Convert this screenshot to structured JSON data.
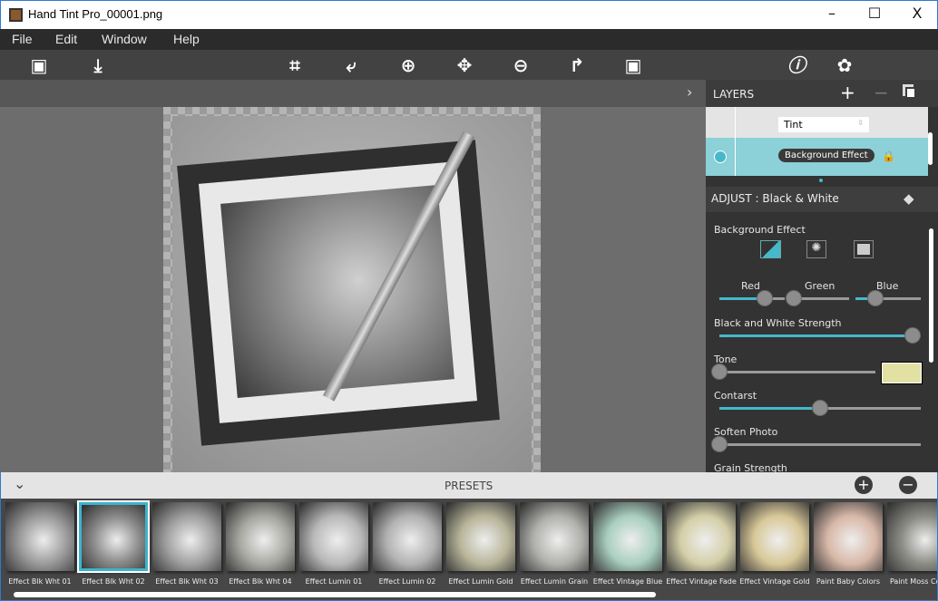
{
  "window": {
    "title": "Hand Tint Pro_00001.png",
    "minimize": "–",
    "maximize": "☐",
    "close": "X"
  },
  "menu": [
    "File",
    "Edit",
    "Window",
    "Help"
  ],
  "toolbar": {
    "icons": [
      "open-image-icon",
      "save-icon",
      "crop-icon",
      "undo-icon",
      "zoom-in-icon",
      "move-icon",
      "zoom-out-icon",
      "redo-icon",
      "fit-image-icon",
      "info-icon",
      "settings-icon"
    ]
  },
  "layers": {
    "title": "LAYERS",
    "add": "+",
    "remove": "−",
    "blend_mode": "Tint",
    "active_layer": "Background Effect"
  },
  "adjust": {
    "title": "ADJUST : Black & White",
    "section": "Background Effect",
    "sliders": {
      "red": {
        "label": "Red",
        "value": 0.7
      },
      "green": {
        "label": "Green",
        "value": 0.1
      },
      "blue": {
        "label": "Blue",
        "value": 0.3
      },
      "bw_strength": {
        "label": "Black and White Strength",
        "value": 0.96
      },
      "tone": {
        "label": "Tone",
        "value": 0.0,
        "color": "#e3e0a4"
      },
      "contrast": {
        "label": "Contarst",
        "value": 0.5
      },
      "soften": {
        "label": "Soften Photo",
        "value": 0.0
      },
      "grain": {
        "label": "Grain Strength"
      }
    }
  },
  "presets": {
    "title": "PRESETS",
    "add": "+",
    "remove": "−",
    "selected": 1,
    "items": [
      {
        "label": "Effect Blk Wht 01",
        "tint": "#9a9a9a"
      },
      {
        "label": "Effect Blk Wht 02",
        "tint": "#8e8e8e"
      },
      {
        "label": "Effect Blk Wht 03",
        "tint": "#a0a0a0"
      },
      {
        "label": "Effect Blk Wht 04",
        "tint": "#a8a8a2"
      },
      {
        "label": "Effect Lumin 01",
        "tint": "#b8b8b8"
      },
      {
        "label": "Effect Lumin 02",
        "tint": "#b2b2b2"
      },
      {
        "label": "Effect Lumin Gold",
        "tint": "#b8b59a"
      },
      {
        "label": "Effect Lumin Grain",
        "tint": "#b0b0ac"
      },
      {
        "label": "Effect Vintage Blue",
        "tint": "#a9cfc0"
      },
      {
        "label": "Effect Vintage Fade",
        "tint": "#d4cfa8"
      },
      {
        "label": "Effect Vintage Gold",
        "tint": "#d8c898"
      },
      {
        "label": "Paint Baby Colors",
        "tint": "#d8b8a8"
      },
      {
        "label": "Paint Moss Colors",
        "tint": "#8a8c84"
      }
    ]
  }
}
